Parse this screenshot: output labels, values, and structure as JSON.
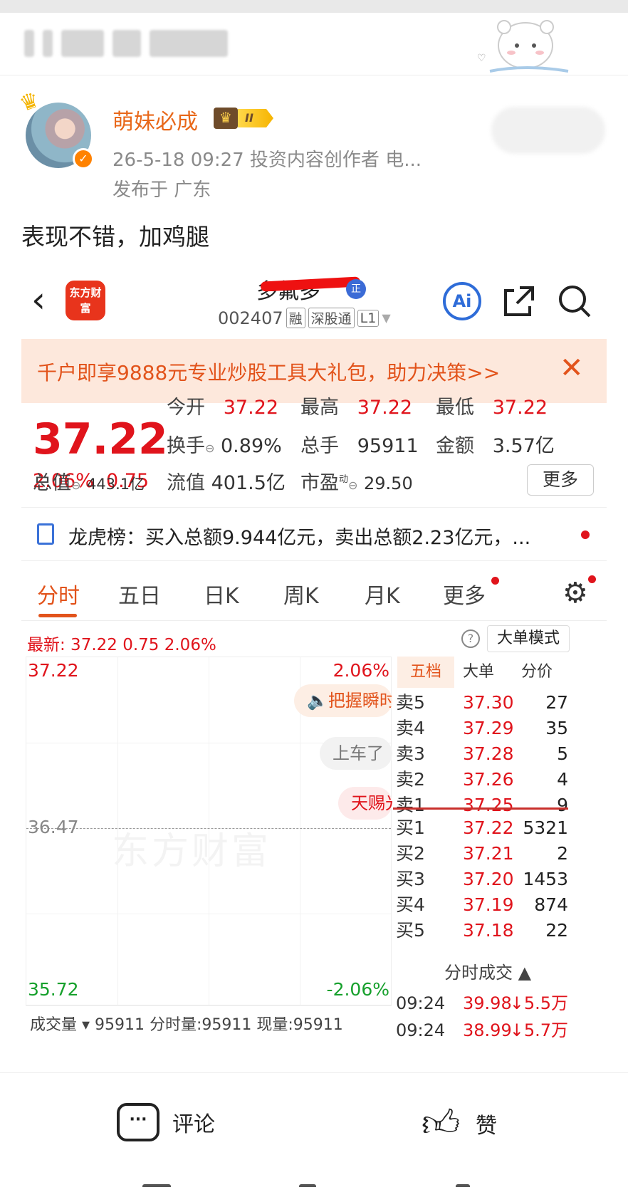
{
  "post": {
    "author_name": "萌妹必成",
    "level_label": "II",
    "meta_time": "26-5-18 09:27  投资内容创作者 电...",
    "meta_location": "发布于 广东",
    "text": "表现不错，加鸡腿"
  },
  "app": {
    "logo_text": "东方财富",
    "stock_name": "多氟多",
    "stock_badge": "正",
    "code": "002407",
    "tags": [
      "融",
      "深股通",
      "L1"
    ],
    "ai_label": "Ai",
    "promo": "千户即享9888元专业炒股工具大礼包，助力决策>>",
    "price": "37.22",
    "change_pct": "2.06%",
    "change_amt": "0.75",
    "stats": {
      "open_label": "今开",
      "open": "37.22",
      "high_label": "最高",
      "high": "37.22",
      "low_label": "最低",
      "low": "37.22",
      "turnover_label": "换手",
      "turnover": "0.89%",
      "volume_label": "总手",
      "volume": "95911",
      "amount_label": "金额",
      "amount": "3.57亿",
      "mktcap_label": "总值",
      "mktcap": "443.1亿",
      "float_label": "流值",
      "float": "401.5亿",
      "pe_label": "市盈",
      "pe_sup": "动",
      "pe": "29.50",
      "more": "更多"
    },
    "lhb": "龙虎榜：买入总额9.944亿元，卖出总额2.23亿元，...",
    "tabs": [
      "分时",
      "五日",
      "日K",
      "周K",
      "月K",
      "更多"
    ],
    "latest": "最新: 37.22  0.75  2.06%",
    "big_order_mode": "大单模式",
    "chart": {
      "top_price": "37.22",
      "top_pct": "2.06%",
      "mid_price": "36.47",
      "bottom_price": "35.72",
      "bottom_pct": "-2.06%",
      "watermark": "东方财富",
      "bubbles": [
        "把握瞬时",
        "上车了",
        "天赐光"
      ],
      "volume_text": "成交量 ▾  95911   分时量:95911   现量:95911"
    },
    "book": {
      "tabs": [
        "五档",
        "大单",
        "分价"
      ],
      "asks": [
        {
          "label": "卖5",
          "price": "37.30",
          "qty": "27"
        },
        {
          "label": "卖4",
          "price": "37.29",
          "qty": "35"
        },
        {
          "label": "卖3",
          "price": "37.28",
          "qty": "5"
        },
        {
          "label": "卖2",
          "price": "37.26",
          "qty": "4"
        },
        {
          "label": "卖1",
          "price": "37.25",
          "qty": "9"
        }
      ],
      "bids": [
        {
          "label": "买1",
          "price": "37.22",
          "qty": "5321"
        },
        {
          "label": "买2",
          "price": "37.21",
          "qty": "2"
        },
        {
          "label": "买3",
          "price": "37.20",
          "qty": "1453"
        },
        {
          "label": "买4",
          "price": "37.19",
          "qty": "874"
        },
        {
          "label": "买5",
          "price": "37.18",
          "qty": "22"
        }
      ],
      "ticks_title": "分时成交 ▲",
      "ticks": [
        {
          "time": "09:24",
          "price": "39.98",
          "vol": "↓5.5万"
        },
        {
          "time": "09:24",
          "price": "38.99",
          "vol": "↓5.7万"
        }
      ]
    }
  },
  "actions": {
    "comment": "评论",
    "like": "赞"
  },
  "colors": {
    "up": "#e0141c",
    "down": "#16a02c",
    "accent": "#e2531b",
    "author": "#e8681a"
  }
}
